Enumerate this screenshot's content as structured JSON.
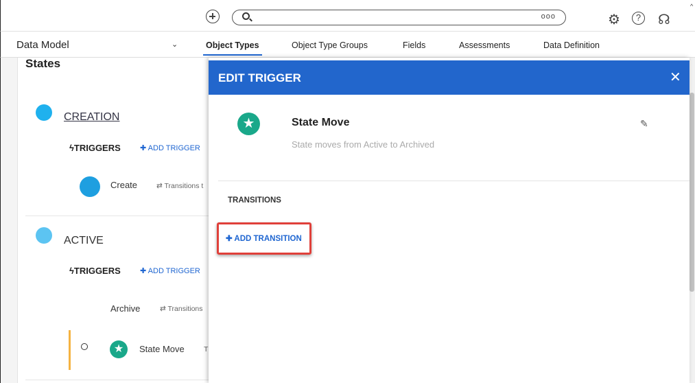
{
  "header": {
    "search_more": "ooo"
  },
  "nav": {
    "title": "Data Model",
    "tabs": [
      {
        "label": "Object Types",
        "active": true
      },
      {
        "label": "Object Type Groups",
        "active": false
      },
      {
        "label": "Fields",
        "active": false
      },
      {
        "label": "Assessments",
        "active": false
      },
      {
        "label": "Data Definition",
        "active": false
      }
    ]
  },
  "page": {
    "title": "States",
    "states": [
      {
        "name": "CREATION",
        "color": "#1fb1ee",
        "triggers_label": "TRIGGERS",
        "add_trigger": "ADD TRIGGER",
        "triggers": [
          {
            "name": "Create",
            "transitions": "Transitions t"
          }
        ]
      },
      {
        "name": "ACTIVE",
        "color": "#5cc4f2",
        "triggers_label": "TRIGGERS",
        "add_trigger": "ADD TRIGGER",
        "triggers": [
          {
            "name": "Archive",
            "transitions": "Transitions"
          },
          {
            "name": "State Move",
            "transitions": "T"
          }
        ]
      }
    ]
  },
  "drawer": {
    "title": "EDIT TRIGGER",
    "trigger_name": "State Move",
    "trigger_description": "State moves from Active to Archived",
    "transitions_label": "TRANSITIONS",
    "add_transition_label": "ADD TRANSITION"
  },
  "colors": {
    "header_blue": "#2266cc",
    "link_blue": "#1f66d1",
    "highlight_red": "#e0403a",
    "star_green": "#1aa88a"
  }
}
